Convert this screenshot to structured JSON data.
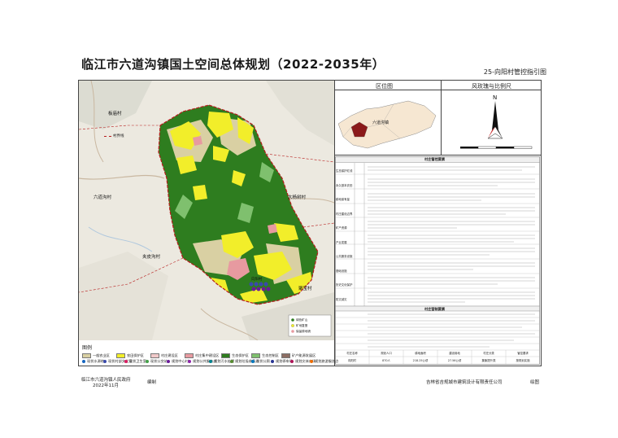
{
  "title": "临江市六道沟镇国土空间总体规划（2022-2035年）",
  "subtitle": "25-向阳村管控指引图",
  "panels": {
    "inset_title": "区位图",
    "compass_title": "风玫瑰与比例尺"
  },
  "inset": {
    "town_label": "六道沟镇"
  },
  "map": {
    "villages": [
      "板庙村",
      "六道沟村",
      "大杨树村",
      "夹皮沟村",
      "聚宝村",
      "向阳村"
    ],
    "boundary_label": "村界线"
  },
  "map_legend": {
    "item1": "绿色矿山",
    "item2": "矿地复垦",
    "item3": "保留原地貌"
  },
  "table": {
    "title": "村庄管控要素",
    "row_labels": [
      "生态保护红线",
      "永久基本农田",
      "耕地保有量",
      "村庄建设边界",
      "矿产资源",
      "产业发展",
      "公共服务设施",
      "基础设施",
      "历史文化保护",
      "防灾减灾",
      "土地整治"
    ],
    "sub_title": "村庄营制要素",
    "bottom_headers": [
      "村庄名称",
      "规划人口",
      "耕地面积",
      "建设用地",
      "村庄分类",
      "管控要求"
    ],
    "bottom_row": [
      "向阳村",
      "870人",
      "218.25公顷",
      "27.56公顷",
      "集聚提升类",
      "按规划实施"
    ]
  },
  "legend": {
    "title": "图例",
    "items": [
      "一般农业区",
      "农田保护区",
      "村庄建设区",
      "村庄集中建设区",
      "生态保护区",
      "生态控制区",
      "矿产能源发展区"
    ],
    "points": [
      "现状水源地",
      "现状村部文化室",
      "现状卫生室",
      "现状公交站",
      "规划中心村",
      "规划公共服务点",
      "规划污水处理",
      "规划垃圾收集点",
      "现状公厕",
      "规划停车场",
      "规划文体广场",
      "规划旅游服务点"
    ]
  },
  "footer": {
    "org": "临江市六道沟镇人民政府",
    "date": "2022年11月",
    "compile": "编制",
    "company": "吉林省吉规城市建筑设计有限责任公司",
    "draw": "绘图"
  },
  "colors": {
    "forest": "#2e7d1f",
    "cropland": "#f2ee2a",
    "settlement": "#e79aa0",
    "farm_general": "#d9d0a3",
    "boundary": "#b71c1c"
  }
}
